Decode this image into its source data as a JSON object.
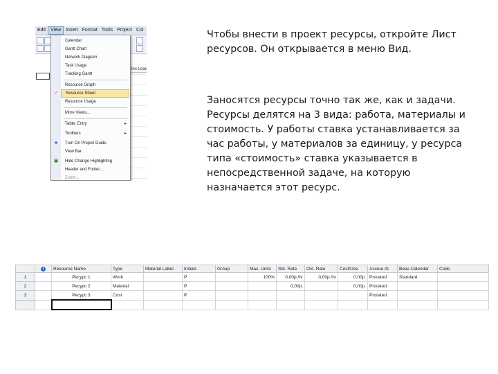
{
  "menubar": {
    "items": [
      "Edit",
      "View",
      "Insert",
      "Format",
      "Tools",
      "Project",
      "Col"
    ],
    "active": "View"
  },
  "grid_header_fragment": "Res Lead",
  "view_menu": {
    "items": [
      {
        "label": "Calendar"
      },
      {
        "label": "Gantt Chart"
      },
      {
        "label": "Network Diagram"
      },
      {
        "label": "Task Usage"
      },
      {
        "label": "Tracking Gantt"
      },
      {
        "label": "Resource Graph"
      },
      {
        "label": "Resource Sheet",
        "highlighted": true,
        "checked": true
      },
      {
        "label": "Resource Usage"
      },
      {
        "label": "More Views..."
      },
      {
        "label": "Table: Entry",
        "submenu": true
      },
      {
        "label": "Toolbars",
        "submenu": true
      },
      {
        "label": "Turn On Project Guide",
        "icon": "project-guide-icon"
      },
      {
        "label": "View Bar"
      },
      {
        "label": "Hide Change Highlighting",
        "icon": "highlight-icon"
      },
      {
        "label": "Header and Footer..."
      },
      {
        "label": "Zoom...",
        "dim": true
      }
    ]
  },
  "text": {
    "para1": "Чтобы внести в проект ресурсы, откройте Лист ресурсов. Он открывается в меню Вид.",
    "para2": "Заносятся ресурсы точно так же, как и задачи. Ресурсы делятся на 3 вида: работа, материалы и стоимость. У работы ставка устанавливается за час работы, у материалов за единицу, у ресурса типа «стоимость» ставка указывается в непосредственной задаче, на которую назначается этот ресурс."
  },
  "resource_sheet": {
    "columns": [
      "",
      "i",
      "Resource Name",
      "Type",
      "Material Label",
      "Initials",
      "Group",
      "Max. Units",
      "Std. Rate",
      "Ovt. Rate",
      "Cost/Use",
      "Accrue At",
      "Base Calendar",
      "Code"
    ],
    "rows": [
      {
        "num": "1",
        "name": "Ресурс 1",
        "type": "Work",
        "material_label": "",
        "initials": "Р",
        "group": "",
        "max_units": "100%",
        "std_rate": "0,00р./hr",
        "ovt_rate": "0,00р./hr",
        "cost_use": "0,00р.",
        "accrue_at": "Prorated",
        "base_calendar": "Standard",
        "code": ""
      },
      {
        "num": "2",
        "name": "Ресурс 2",
        "type": "Material",
        "material_label": "",
        "initials": "Р",
        "group": "",
        "max_units": "",
        "std_rate": "0,00р.",
        "ovt_rate": "",
        "cost_use": "0,00р.",
        "accrue_at": "Prorated",
        "base_calendar": "",
        "code": ""
      },
      {
        "num": "3",
        "name": "Ресурс 3",
        "type": "Cost",
        "material_label": "",
        "initials": "Р",
        "group": "",
        "max_units": "",
        "std_rate": "",
        "ovt_rate": "",
        "cost_use": "",
        "accrue_at": "Prorated",
        "base_calendar": "",
        "code": ""
      }
    ]
  }
}
